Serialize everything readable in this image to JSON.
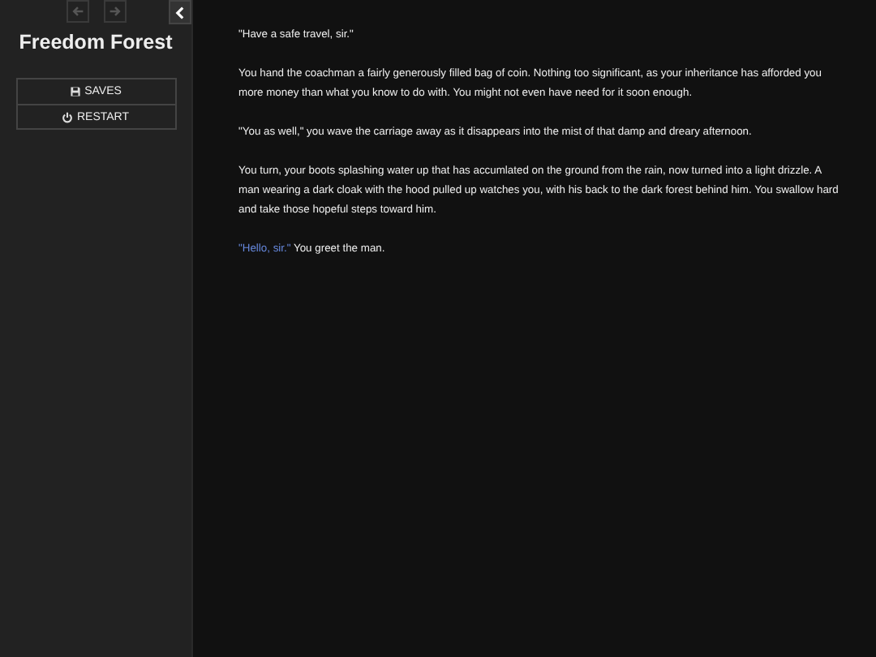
{
  "sidebar": {
    "history_back": {
      "disabled": true
    },
    "history_forward": {
      "disabled": true
    },
    "title": "Freedom Forest",
    "menu": [
      {
        "kind": "saves",
        "label": "SAVES"
      },
      {
        "kind": "restart",
        "label": "RESTART"
      }
    ]
  },
  "passage": [
    {
      "kind": "text",
      "text": "\"Have a safe travel, sir.\""
    },
    {
      "kind": "text",
      "text": "You hand the coachman a fairly generously filled bag of coin. Nothing too significant, as your inheritance has afforded you more money than what you know to do with. You might not even have need for it soon enough."
    },
    {
      "kind": "text",
      "text": "\"You as well,\" you wave the carriage away as it disappears into the mist of that damp and dreary afternoon."
    },
    {
      "kind": "text",
      "text": "You turn, your boots splashing water up that has accumlated on the ground from the rain, now turned into a light drizzle. A man wearing a dark cloak with the hood pulled up watches you, with his back to the dark forest behind him. You swallow hard and take those hopeful steps toward him."
    },
    {
      "kind": "link",
      "link": "\"Hello, sir.\"",
      "text": "You greet the man."
    }
  ]
}
